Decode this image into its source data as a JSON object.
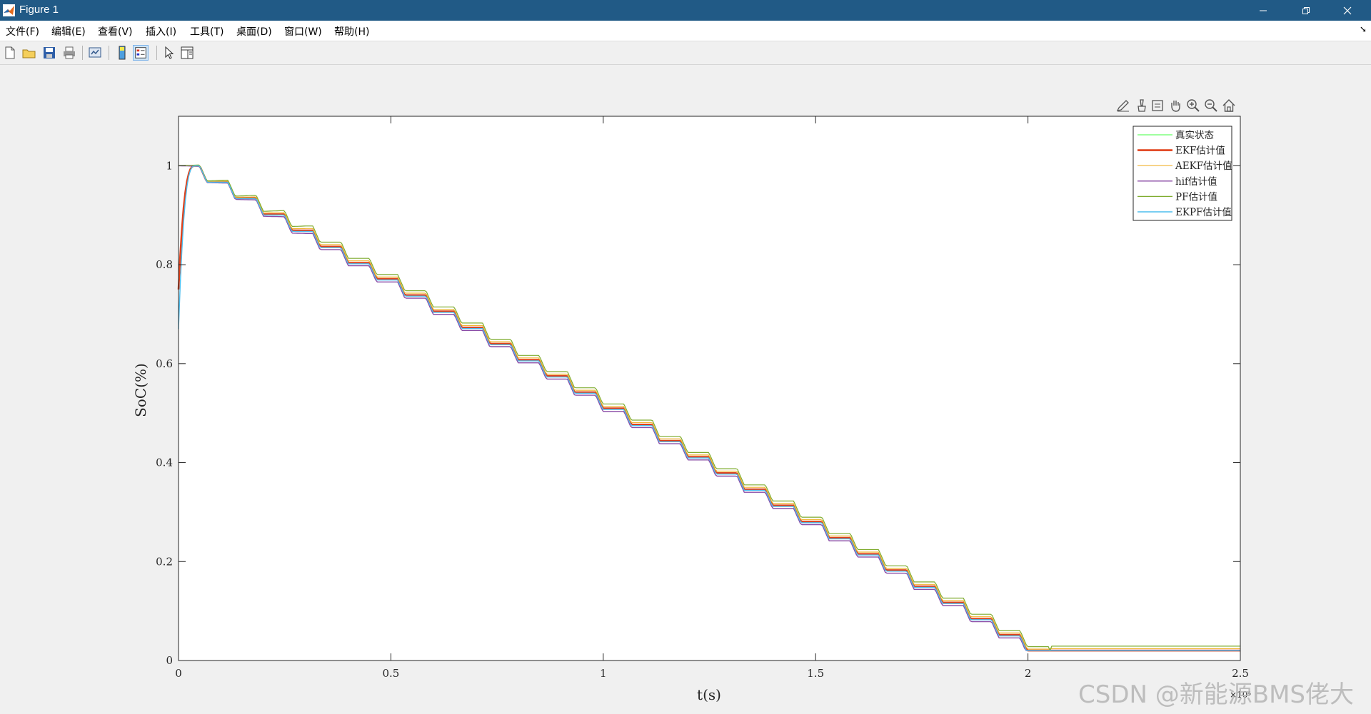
{
  "window": {
    "title": "Figure 1",
    "controls": [
      "minimize",
      "restore",
      "close"
    ]
  },
  "menu": {
    "items": [
      "文件(F)",
      "编辑(E)",
      "查看(V)",
      "插入(I)",
      "工具(T)",
      "桌面(D)",
      "窗口(W)",
      "帮助(H)"
    ]
  },
  "toolbar": {
    "buttons": [
      "new-figure-icon",
      "open-file-icon",
      "save-icon",
      "print-icon",
      "link-plot-icon",
      "colorbar-icon",
      "legend-icon",
      "pointer-icon",
      "property-editor-icon"
    ],
    "active": "legend-icon"
  },
  "axes_toolbar": {
    "buttons": [
      "edit-plot-icon",
      "brush-icon",
      "data-tips-icon",
      "pan-icon",
      "zoom-in-icon",
      "zoom-out-icon",
      "home-icon"
    ]
  },
  "chart_data": {
    "type": "line",
    "title": "",
    "xlabel": "t(s)",
    "ylabel": "SoC(%)",
    "xlim": [
      0,
      25000
    ],
    "ylim": [
      0,
      1.1
    ],
    "x_exponent": "×10⁴",
    "xticks": [
      0,
      5000,
      10000,
      15000,
      20000,
      25000
    ],
    "xtick_labels": [
      "0",
      "0.5",
      "1",
      "1.5",
      "2",
      "2.5"
    ],
    "yticks": [
      0,
      0.2,
      0.4,
      0.6,
      0.8,
      1.0
    ],
    "ytick_labels": [
      "0",
      "0.2",
      "0.4",
      "0.6",
      "0.8",
      "1"
    ],
    "grid": false,
    "legend_position": "top-right",
    "step_period_s": 666,
    "step_drop": 0.0327,
    "series": [
      {
        "name": "真实状态",
        "color": "#66ff66",
        "width": 1.2,
        "start": 1.0,
        "offset": 0.0,
        "initial": null
      },
      {
        "name": "EKF估计值",
        "color": "#e0401a",
        "width": 2.6,
        "start": 1.0,
        "offset": 0.0,
        "initial": 0.75
      },
      {
        "name": "AEKF估计值",
        "color": "#f0b431",
        "width": 1.2,
        "start": 1.0,
        "offset": 0.004,
        "initial": null
      },
      {
        "name": "hif估计值",
        "color": "#8a4ba6",
        "width": 1.4,
        "start": 0.99,
        "offset": -0.006,
        "initial": null
      },
      {
        "name": "PF估计值",
        "color": "#7fac2f",
        "width": 1.2,
        "start": 1.0,
        "offset": 0.009,
        "initial": null
      },
      {
        "name": "EKPF估计值",
        "color": "#4dbeee",
        "width": 1.4,
        "start": 0.98,
        "offset": -0.002,
        "initial": 0.67
      }
    ]
  },
  "watermark": "CSDN @新能源BMS佬大"
}
